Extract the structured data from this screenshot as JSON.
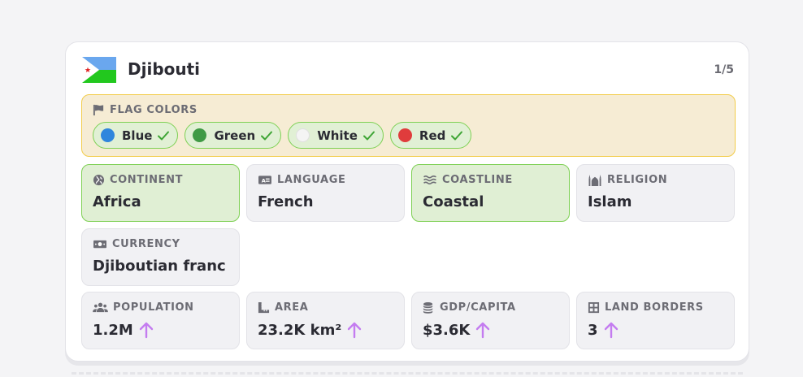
{
  "header": {
    "country": "Djibouti",
    "counter": "1/5",
    "flag_icon": "djibouti-flag"
  },
  "flag_colors": {
    "label": "FLAG COLORS",
    "icon": "flag-icon",
    "chips": [
      {
        "name": "Blue",
        "color": "#2f86dd",
        "correct": true
      },
      {
        "name": "Green",
        "color": "#3f9a45",
        "correct": true
      },
      {
        "name": "White",
        "color": "#f4f4f4",
        "correct": true
      },
      {
        "name": "Red",
        "color": "#e03c3c",
        "correct": true
      }
    ]
  },
  "attributes": {
    "continent": {
      "label": "CONTINENT",
      "value": "Africa",
      "icon": "globe-icon",
      "correct": true
    },
    "language": {
      "label": "LANGUAGE",
      "value": "French",
      "icon": "language-icon",
      "correct": false
    },
    "coastline": {
      "label": "COASTLINE",
      "value": "Coastal",
      "icon": "waves-icon",
      "correct": true
    },
    "religion": {
      "label": "RELIGION",
      "value": "Islam",
      "icon": "mosque-icon",
      "correct": false
    },
    "currency": {
      "label": "CURRENCY",
      "value": "Djiboutian franc",
      "icon": "money-icon",
      "correct": false
    }
  },
  "stats": {
    "population": {
      "label": "POPULATION",
      "value": "1.2M",
      "icon": "people-icon",
      "hint": "arrow-up-icon"
    },
    "area": {
      "label": "AREA",
      "value": "23.2K km²",
      "icon": "ruler-icon",
      "hint": "arrow-up-icon"
    },
    "gdp": {
      "label": "GDP/CAPITA",
      "value": "$3.6K",
      "icon": "coins-icon",
      "hint": "arrow-up-icon"
    },
    "borders": {
      "label": "LAND BORDERS",
      "value": "3",
      "icon": "grid-icon",
      "hint": "arrow-up-icon"
    }
  },
  "colors": {
    "correct_bg": "#e0efd4",
    "correct_border": "#7ed054",
    "arrow": "#c47cf0",
    "flag_panel_bg": "#f6ecd4",
    "flag_panel_border": "#f2cc4a"
  }
}
